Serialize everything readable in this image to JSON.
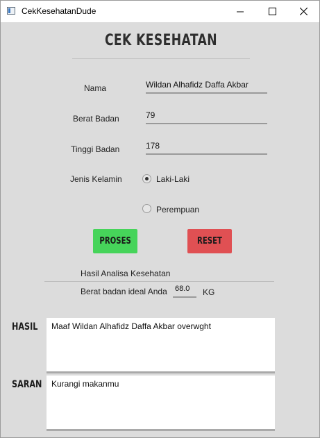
{
  "window": {
    "title": "CekKesehatanDude",
    "controls": {
      "minimize": "minimize",
      "maximize": "maximize",
      "close": "close"
    }
  },
  "header": {
    "title": "CEK KESEHATAN"
  },
  "form": {
    "nama": {
      "label": "Nama",
      "value": "Wildan Alhafidz Daffa Akbar"
    },
    "berat": {
      "label": "Berat Badan",
      "value": "79"
    },
    "tinggi": {
      "label": "Tinggi Badan",
      "value": "178"
    },
    "gender": {
      "label": "Jenis Kelamin",
      "options": [
        {
          "label": "Laki-Laki",
          "selected": true
        },
        {
          "label": "Perempuan",
          "selected": false
        }
      ]
    }
  },
  "buttons": {
    "proses": "PROSES",
    "reset": "RESET"
  },
  "colors": {
    "proses": "#46d45a",
    "reset": "#e05053",
    "background": "#dcdcdc"
  },
  "analysis": {
    "heading": "Hasil Analisa Kesehatan",
    "ideal_label": "Berat badan ideal Anda",
    "ideal_value": "68.0",
    "unit": "KG"
  },
  "hasil": {
    "label": "HASIL",
    "text": "Maaf Wildan Alhafidz Daffa Akbar overwght"
  },
  "saran": {
    "label": "SARAN",
    "text": "Kurangi makanmu"
  }
}
